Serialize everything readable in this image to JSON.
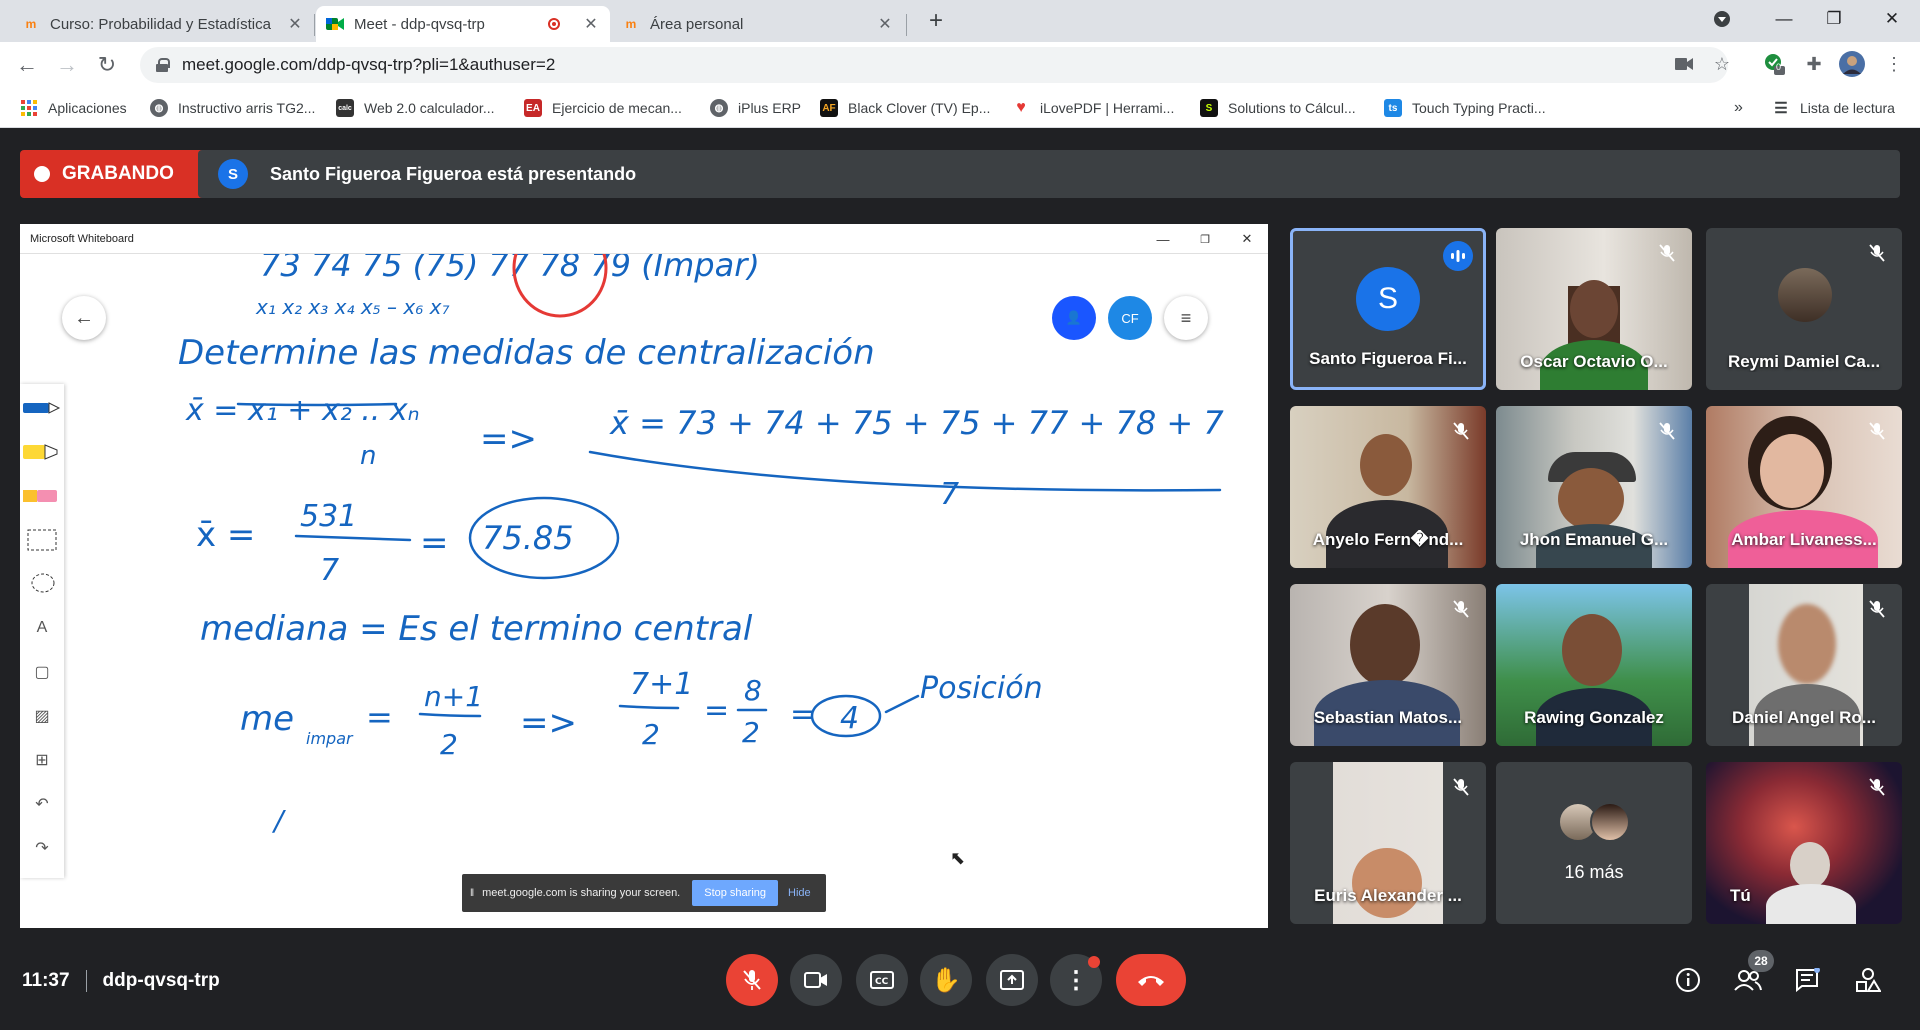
{
  "browser": {
    "tabs": [
      {
        "title": "Curso: Probabilidad y Estadística",
        "favicon": "moodle-icon",
        "active": false
      },
      {
        "title": "Meet - ddp-qvsq-trp",
        "favicon": "google-meet-icon",
        "active": true,
        "recording": true
      },
      {
        "title": "Área personal",
        "favicon": "moodle-icon",
        "active": false
      }
    ],
    "new_tab": "+",
    "url": "meet.google.com/ddp-qvsq-trp?pli=1&authuser=2",
    "extension_badge": "0",
    "bookmarks": [
      {
        "label": "Aplicaciones",
        "icon": "apps-grid-icon"
      },
      {
        "label": "Instructivo arris TG2...",
        "icon": "globe-icon"
      },
      {
        "label": "Web 2.0 calculador...",
        "icon": "calculator-icon"
      },
      {
        "label": "Ejercicio de mecan...",
        "icon": "ejercicio-icon"
      },
      {
        "label": "iPlus ERP",
        "icon": "globe-icon"
      },
      {
        "label": "Black Clover (TV) Ep...",
        "icon": "af-icon"
      },
      {
        "label": "iLovePDF | Herrami...",
        "icon": "heart-icon"
      },
      {
        "label": "Solutions to Cálcul...",
        "icon": "s-icon"
      },
      {
        "label": "Touch Typing Practi...",
        "icon": "ts-icon"
      }
    ],
    "bookmarks_overflow": "»",
    "reading_list": "Lista de lectura"
  },
  "meet": {
    "recording_label": "GRABANDO",
    "presenter_initial": "S",
    "presenting_text": "Santo Figueroa Figueroa está presentando",
    "whiteboard": {
      "window_title": "Microsoft Whiteboard",
      "collab_initials": "CF",
      "ink_lines": {
        "row1": "73   74   75   (75)   77   78   79   (Impar)",
        "row1_subs": "x₁   x₂   x₃   x₄   x₅ – x₆   x₇",
        "heading": "Determine las medidas de centralización",
        "mean_formula_lhs": "x̄ = x₁ + x₂ .. xₙ",
        "mean_formula_den": "n",
        "mean_formula_rhs": "x̄ = 73 + 74 + 75 + 75 + 77 + 78 + 7",
        "mean_rhs_den": "7",
        "mean_result_num": "531",
        "mean_result_den": "7",
        "mean_result": "75.85",
        "median_def": "mediana = Es el termino central",
        "median_formula": "me",
        "median_sub": "impar",
        "median_frac_num": "n+1",
        "median_frac_den": "2",
        "median_sub_num": "7+1",
        "median_sub_den": "2",
        "median_eval_num": "8",
        "median_eval_den": "2",
        "median_position": "4",
        "position_label": "Posición"
      },
      "share_bar": {
        "text": "meet.google.com is sharing your screen.",
        "stop": "Stop sharing",
        "hide": "Hide"
      }
    },
    "participants": [
      {
        "name": "Santo Figueroa Fi...",
        "type": "avatar",
        "initial": "S",
        "speaking": true
      },
      {
        "name": "Oscar Octavio O...",
        "type": "video",
        "muted": true
      },
      {
        "name": "Reymi Damiel Ca...",
        "type": "photo",
        "muted": true
      },
      {
        "name": "Anyelo Fern�nd...",
        "type": "video",
        "muted": true
      },
      {
        "name": "Jhon Emanuel G...",
        "type": "video",
        "muted": true
      },
      {
        "name": "Ambar Livaness...",
        "type": "video",
        "muted": true
      },
      {
        "name": "Sebastian Matos...",
        "type": "video",
        "muted": true
      },
      {
        "name": "Rawing Gonzalez",
        "type": "video",
        "muted": false
      },
      {
        "name": "Daniel Angel Ro...",
        "type": "video",
        "muted": true
      },
      {
        "name": "Euris Alexander ...",
        "type": "video",
        "muted": true
      },
      {
        "name": "16 más",
        "type": "more"
      },
      {
        "name": "Tú",
        "type": "video",
        "muted": true
      }
    ],
    "bottom": {
      "time": "11:37",
      "meeting_code": "ddp-qvsq-trp",
      "people_count": "28"
    },
    "colors": {
      "recording_red": "#d93025",
      "ink_blue": "#1565c0",
      "accent_blue": "#8ab4f8",
      "hangup_red": "#ea4335"
    }
  }
}
